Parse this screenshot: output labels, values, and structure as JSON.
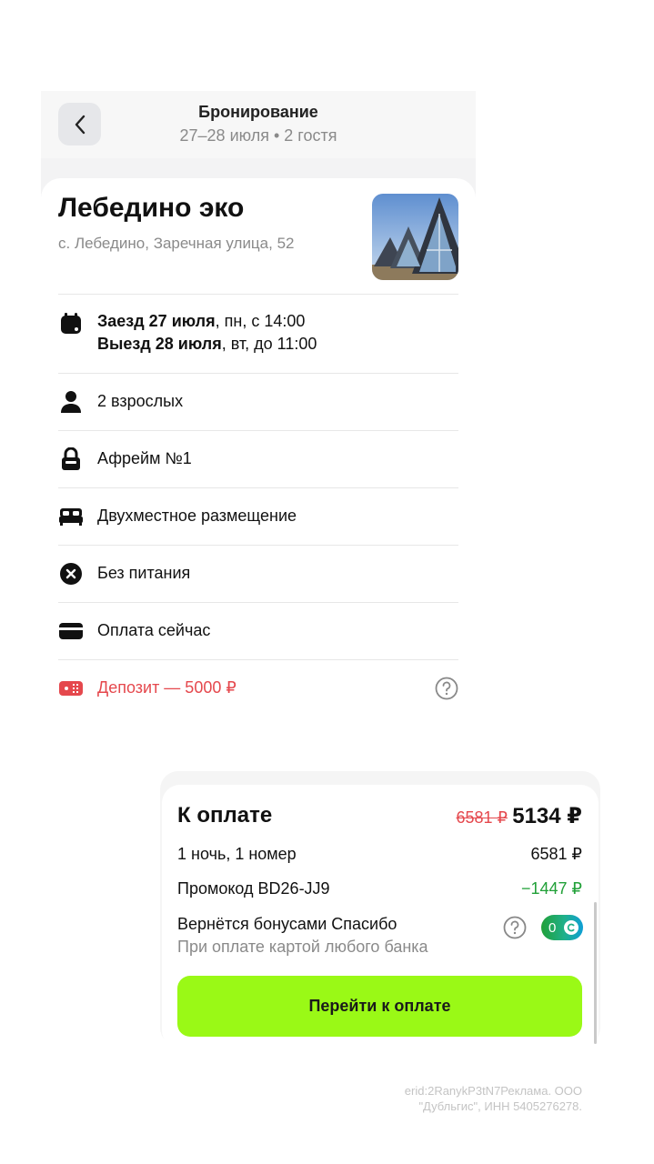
{
  "header": {
    "title": "Бронирование",
    "subtitle": "27–28 июля • 2 гостя"
  },
  "hotel": {
    "name": "Лебедино эко",
    "address": "с. Лебедино, Заречная улица, 52"
  },
  "details": {
    "checkin_bold": "Заезд 27 июля",
    "checkin_rest": ", пн, с 14:00",
    "checkout_bold": "Выезд 28 июля",
    "checkout_rest": ", вт, до 11:00",
    "guests": "2 взрослых",
    "room": "Афрейм №1",
    "accommodation": "Двухместное размещение",
    "meals": "Без питания",
    "payment": "Оплата сейчас",
    "deposit": "Депозит — 5000 ₽"
  },
  "payment": {
    "title": "К оплате",
    "old_price": "6581 ₽",
    "total": "5134 ₽",
    "nights_label": "1 ночь, 1 номер",
    "nights_value": "6581 ₽",
    "promo_label": "Промокод BD26-JJ9",
    "promo_value": "−1447 ₽",
    "bonus_label": "Вернётся бонусами Спасибо",
    "bonus_sub": "При оплате картой любого банка",
    "bonus_value": "0",
    "button": "Перейти к оплате"
  },
  "legal": "erid:2RanykP3tN7Реклама. ООО \"Дубльгис\", ИНН 5405276278.",
  "colors": {
    "accent_button": "#9af916",
    "deposit_red": "#e5484d",
    "discount_green": "#21a038"
  },
  "icons": [
    "back-chevron-icon",
    "calendar-icon",
    "person-icon",
    "lock-icon",
    "bed-icon",
    "close-circle-icon",
    "card-icon",
    "deposit-card-icon",
    "help-icon",
    "sber-spasibo-icon"
  ]
}
